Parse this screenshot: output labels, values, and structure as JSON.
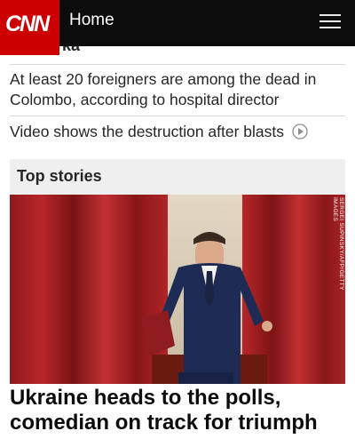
{
  "header": {
    "logo_text": "CNN",
    "home_label": "Home",
    "menu_icon": "hamburger-menu-icon",
    "brand_color": "#cc0000"
  },
  "partial_headline": "ka",
  "stories": [
    {
      "headline": "At least 20 foreigners are among the dead in Colombo, according to hospital director"
    },
    {
      "headline": "Video shows the destruction after blasts",
      "icon": "play-circle-icon"
    }
  ],
  "section": {
    "title": "Top stories"
  },
  "hero": {
    "image_credit": "SERGEI SUPINSKY/AFP/GETTY IMAGES",
    "headline": "Ukraine heads to the polls, comedian on track for triumph"
  }
}
